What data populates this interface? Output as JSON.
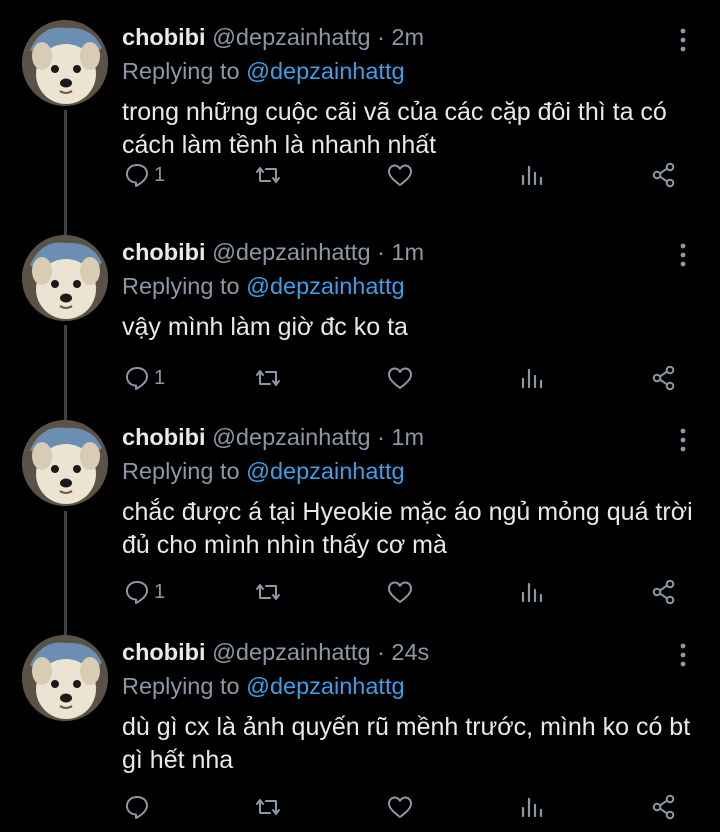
{
  "tweets": [
    {
      "name": "chobibi",
      "handle": "@depzainhattg",
      "separator": "·",
      "time": "2m",
      "replying_prefix": "Replying to",
      "replying_handle": "@depzainhattg",
      "text": "trong những cuộc cãi vã của các cặp đôi thì ta có cách làm tềnh là nhanh nhất",
      "reply_count": "1"
    },
    {
      "name": "chobibi",
      "handle": "@depzainhattg",
      "separator": "·",
      "time": "1m",
      "replying_prefix": "Replying to",
      "replying_handle": "@depzainhattg",
      "text": "vậy mình làm giờ đc ko ta",
      "reply_count": "1"
    },
    {
      "name": "chobibi",
      "handle": "@depzainhattg",
      "separator": "·",
      "time": "1m",
      "replying_prefix": "Replying to",
      "replying_handle": "@depzainhattg",
      "text": "chắc được á tại Hyeokie mặc áo ngủ mỏng quá trời đủ cho mình nhìn thấy cơ mà",
      "reply_count": "1"
    },
    {
      "name": "chobibi",
      "handle": "@depzainhattg",
      "separator": "·",
      "time": "24s",
      "replying_prefix": "Replying to",
      "replying_handle": "@depzainhattg",
      "text": "dù gì cx là ảnh quyến rũ mềnh trước, mình ko có bt gì hết nha",
      "reply_count": ""
    }
  ],
  "icons": {
    "reply": "reply-icon",
    "retweet": "retweet-icon",
    "like": "heart-icon",
    "analytics": "analytics-icon",
    "share": "share-icon",
    "more": "more-vertical-icon"
  },
  "colors": {
    "background": "#000000",
    "text": "#e7e9ea",
    "muted": "#8b98a5",
    "link": "#3d9ee6",
    "thread_line": "#3d4147"
  }
}
